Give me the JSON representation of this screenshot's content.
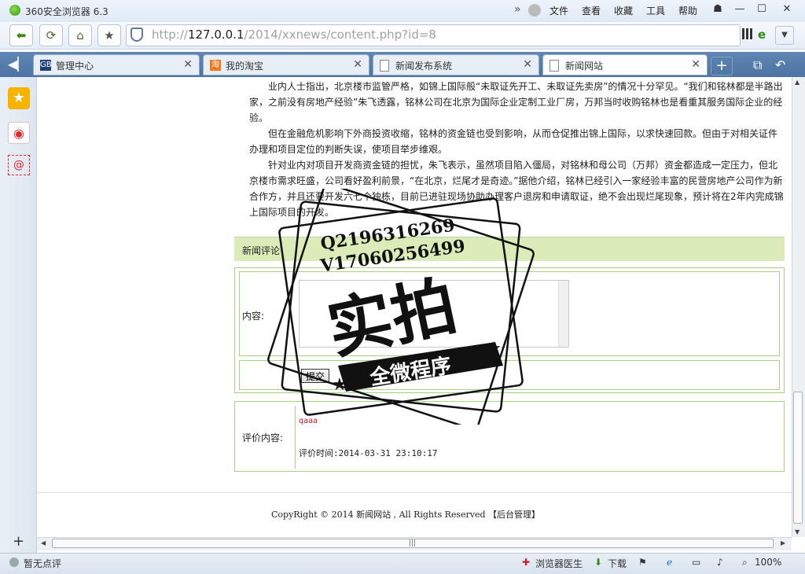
{
  "window": {
    "title": "360安全浏览器 6.3",
    "menus": [
      "文件",
      "查看",
      "收藏",
      "工具",
      "帮助"
    ]
  },
  "address": {
    "prefix": "http://",
    "host": "127.0.0.1",
    "path": "/2014/xxnews/content.php?id=8"
  },
  "tabs": [
    {
      "label": "管理中心",
      "icon": "GB",
      "active": false
    },
    {
      "label": "我的淘宝",
      "icon": "淘",
      "active": false
    },
    {
      "label": "新闻发布系统",
      "icon": "page",
      "active": false
    },
    {
      "label": "新闻网站",
      "icon": "page",
      "active": true
    }
  ],
  "article": {
    "paragraphs": [
      "业内人士指出，北京楼市监管严格，如锦上国际般“未取证先开工、未取证先卖房”的情况十分罕见。“我们和铭林都是半路出家，之前没有房地产经验”朱飞透露，铭林公司在北京为国际企业定制工业厂房，万邦当时收购铭林也是看重其服务国际企业的经验。",
      "但在金融危机影响下外商投资收缩，铭林的资金链也受到影响，从而仓促推出锦上国际，以求快速回款。但由于对相关证件办理和项目定位的判断失误，使项目举步维艰。",
      "针对业内对项目开发商资金链的担忧，朱飞表示，虽然项目陷入僵局，对铭林和母公司（万邦）资金都造成一定压力，但北京楼市需求旺盛，公司看好盈利前景，“在北京，烂尾才是奇迹。”据他介绍，铭林已经引入一家经验丰富的民营房地产公司作为新合作方，并且还要开发六七个独栋，目前已进驻现场协助办理客户退房和申请取证，绝不会出现烂尾现象，预计将在2年内完成锦上国际项目的开发。"
    ]
  },
  "comments": {
    "section_title": "新闻评论",
    "content_label": "内容:",
    "submit_label": "提交",
    "review_label": "评价内容:",
    "review_text": "qaaa",
    "review_time": "评价时间:2014-03-31 23:10:17"
  },
  "footer": {
    "text": "CopyRight © 2014 新闻网站 , All Rights Reserved 【后台管理】"
  },
  "watermark": {
    "line1": "Q2196316269",
    "line2": "V17060256499",
    "big": "实拍",
    "banner": "全微程序"
  },
  "status": {
    "left": "暂无点评",
    "doctor": "浏览器医生",
    "download": "下载",
    "zoom": "100%"
  },
  "colors": {
    "tabbar": "#5f86b3",
    "comment_head": "#dcecb8",
    "form_border": "#a8d288"
  }
}
